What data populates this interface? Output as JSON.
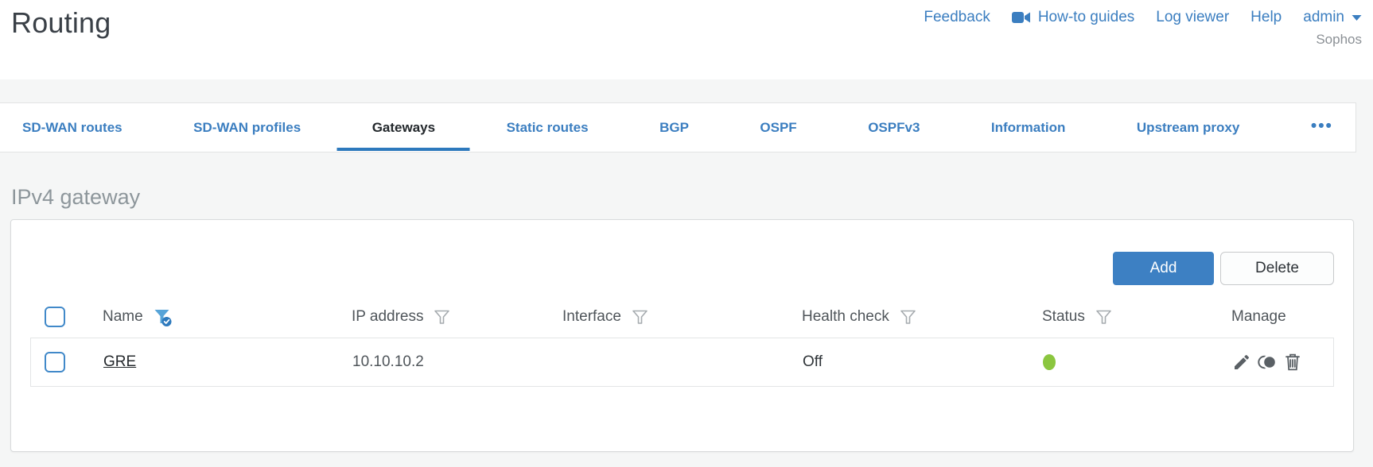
{
  "header": {
    "title": "Routing",
    "links": [
      "Feedback",
      "How-to guides",
      "Log viewer",
      "Help"
    ],
    "user": "admin",
    "brand": "Sophos"
  },
  "tabbar": {
    "tabs": [
      {
        "label": "SD-WAN routes",
        "active": false
      },
      {
        "label": "SD-WAN profiles",
        "active": false
      },
      {
        "label": "Gateways",
        "active": true
      },
      {
        "label": "Static routes",
        "active": false
      },
      {
        "label": "BGP",
        "active": false
      },
      {
        "label": "OSPF",
        "active": false
      },
      {
        "label": "OSPFv3",
        "active": false
      },
      {
        "label": "Information",
        "active": false
      },
      {
        "label": "Upstream proxy",
        "active": false
      },
      {
        "label": "•••",
        "active": false
      }
    ]
  },
  "section": {
    "title": "IPv4 gateway"
  },
  "toolbar": {
    "add_label": "Add",
    "delete_label": "Delete"
  },
  "table": {
    "columns": [
      {
        "label": "Name",
        "filter": "active"
      },
      {
        "label": "IP address",
        "filter": "inactive"
      },
      {
        "label": "Interface",
        "filter": "inactive"
      },
      {
        "label": "Health check",
        "filter": "inactive"
      },
      {
        "label": "Status",
        "filter": "inactive"
      },
      {
        "label": "Manage",
        "filter": "none"
      }
    ],
    "rows": [
      {
        "name": "GRE",
        "ip_address": "10.10.10.2",
        "interface": "",
        "health_check": "Off",
        "status": "up",
        "status_color": "#8bc63f",
        "manage_icons": [
          "edit-icon",
          "deactivate-icon",
          "delete-icon"
        ]
      }
    ]
  },
  "colors": {
    "link_blue": "#3b7ec0",
    "button_blue": "#3d80c3",
    "active_tab_underline": "#2d79bd",
    "active_filter_blue": "#57a4d8",
    "status_green": "#8bc63f"
  }
}
